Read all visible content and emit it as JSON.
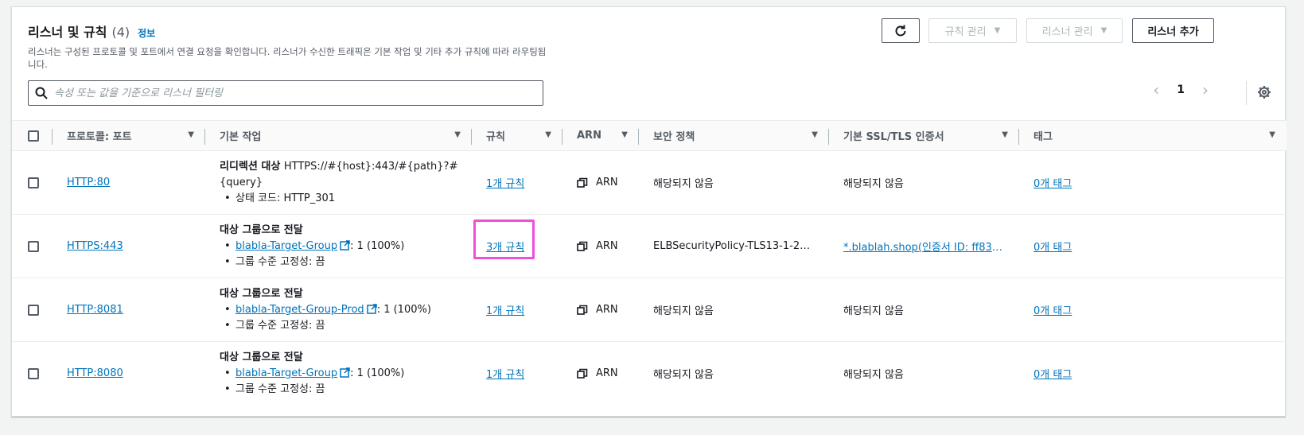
{
  "header": {
    "title": "리스너 및 규칙",
    "count": "(4)",
    "info_link": "정보",
    "description": "리스너는 구성된 프로토콜 및 포트에서 연결 요청을 확인합니다. 리스너가 수신한 트래픽은 기본 작업 및 기타 추가 규칙에 따라 라우팅됩니다."
  },
  "toolbar": {
    "refresh_icon": "refresh-icon",
    "manage_rules_label": "규칙 관리",
    "manage_listener_label": "리스너 관리",
    "add_listener_label": "리스너 추가"
  },
  "search": {
    "placeholder": "속성 또는 값을 기준으로 리스너 필터링",
    "value": ""
  },
  "pagination": {
    "page": "1"
  },
  "table": {
    "columns": {
      "protocol": "프로토콜: 포트",
      "action": "기본 작업",
      "rules": "규칙",
      "arn": "ARN",
      "security": "보안 정책",
      "cert": "기본 SSL/TLS 인증서",
      "tags": "태그"
    },
    "rows": [
      {
        "protocol": "HTTP:80",
        "action_title": "리디렉션 대상",
        "action_target": "HTTPS://#{host}:443/#{path}?#{query}",
        "bullet1": "상태 코드: HTTP_301",
        "rules": "1개 규칙",
        "arn": "ARN",
        "security": "해당되지 않음",
        "cert": "해당되지 않음",
        "tags": "0개 태그"
      },
      {
        "protocol": "HTTPS:443",
        "action_title": "대상 그룹으로 전달",
        "target_group": "blabla-Target-Group",
        "weight": ": 1 (100%)",
        "bullet2": "그룹 수준 고정성: 끔",
        "rules": "3개 규칙",
        "arn": "ARN",
        "security": "ELBSecurityPolicy-TLS13-1-2-…",
        "cert": "*.blablah.shop(인증서 ID: ff830…",
        "tags": "0개 태그"
      },
      {
        "protocol": "HTTP:8081",
        "action_title": "대상 그룹으로 전달",
        "target_group": "blabla-Target-Group-Prod",
        "weight": ": 1 (100%)",
        "bullet2": "그룹 수준 고정성: 끔",
        "rules": "1개 규칙",
        "arn": "ARN",
        "security": "해당되지 않음",
        "cert": "해당되지 않음",
        "tags": "0개 태그"
      },
      {
        "protocol": "HTTP:8080",
        "action_title": "대상 그룹으로 전달",
        "target_group": "blabla-Target-Group",
        "weight": ": 1 (100%)",
        "bullet2": "그룹 수준 고정성: 끔",
        "rules": "1개 규칙",
        "arn": "ARN",
        "security": "해당되지 않음",
        "cert": "해당되지 않음",
        "tags": "0개 태그"
      }
    ]
  },
  "colors": {
    "link": "#0073bb",
    "highlight": "#ef4fd8",
    "border": "#545b64"
  }
}
